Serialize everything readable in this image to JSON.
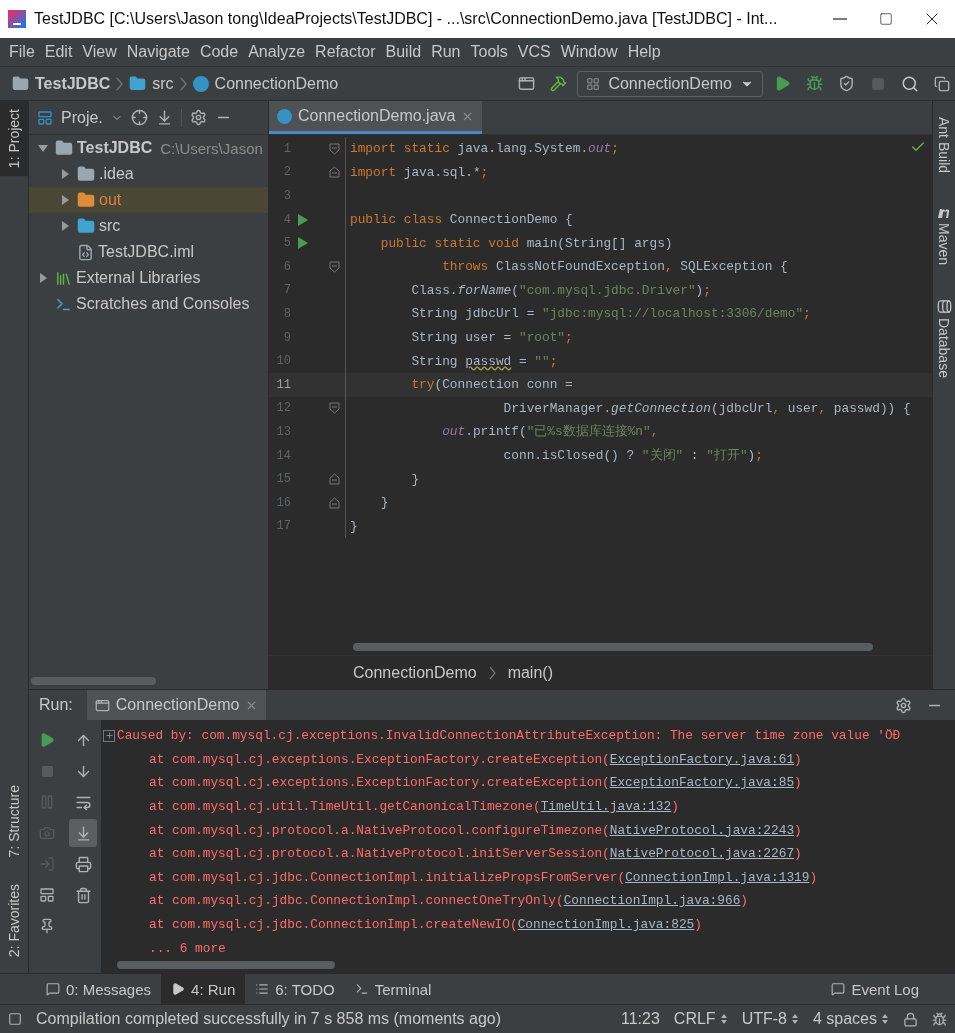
{
  "window": {
    "title": "TestJDBC [C:\\Users\\Jason tong\\IdeaProjects\\TestJDBC] - ...\\src\\ConnectionDemo.java [TestJDBC] - Int..."
  },
  "menu": [
    "File",
    "Edit",
    "View",
    "Navigate",
    "Code",
    "Analyze",
    "Refactor",
    "Build",
    "Run",
    "Tools",
    "VCS",
    "Window",
    "Help"
  ],
  "nav": {
    "breadcrumbs": [
      {
        "label": "TestJDBC",
        "kind": "module"
      },
      {
        "label": "src",
        "kind": "folder"
      },
      {
        "label": "ConnectionDemo",
        "kind": "class"
      }
    ],
    "run_config": "ConnectionDemo"
  },
  "left_stripe": [
    {
      "label": "1: Project",
      "selected": true,
      "kind": "top"
    },
    {
      "label": "7: Structure",
      "selected": false,
      "kind": "bottom"
    },
    {
      "label": "2: Favorites",
      "selected": false,
      "kind": "bottom"
    }
  ],
  "project_panel": {
    "title": "Proje.",
    "tree": [
      {
        "label": "TestJDBC",
        "detail": "C:\\Users\\Jason",
        "kind": "module",
        "expanded": true,
        "selected": false,
        "children": [
          {
            "label": ".idea",
            "kind": "folder",
            "expanded": false,
            "selected": false
          },
          {
            "label": "out",
            "kind": "excluded",
            "expanded": false,
            "selected": true
          },
          {
            "label": "src",
            "kind": "source",
            "expanded": false,
            "selected": false
          },
          {
            "label": "TestJDBC.iml",
            "kind": "file",
            "selected": false
          }
        ]
      },
      {
        "label": "External Libraries",
        "kind": "library",
        "expanded": false,
        "selected": false
      },
      {
        "label": "Scratches and Consoles",
        "kind": "scratch",
        "selected": false
      }
    ]
  },
  "editor": {
    "tabs": [
      {
        "label": "ConnectionDemo.java",
        "selected": true
      }
    ],
    "lines": [
      {
        "number": "1",
        "kind": "fold-start",
        "tokens": [
          {
            "kind": "keyword",
            "text": "import static "
          },
          {
            "kind": "plain",
            "text": "java.lang.System."
          },
          {
            "kind": "field",
            "text": "out"
          },
          {
            "kind": "keyword",
            "text": ";"
          }
        ]
      },
      {
        "number": "2",
        "kind": "fold-end",
        "tokens": [
          {
            "kind": "keyword",
            "text": "import "
          },
          {
            "kind": "plain",
            "text": "java.sql.*"
          },
          {
            "kind": "keyword",
            "text": ";"
          }
        ]
      },
      {
        "number": "3",
        "kind": "plain"
      },
      {
        "number": "4",
        "kind": "run",
        "tokens": [
          {
            "kind": "keyword",
            "text": "public class "
          },
          {
            "kind": "plain",
            "text": "ConnectionDemo {"
          }
        ]
      },
      {
        "number": "5",
        "kind": "run",
        "tokens": [
          {
            "kind": "keyword",
            "text": "    public static void "
          },
          {
            "kind": "plain",
            "text": "main(String[] args)"
          }
        ]
      },
      {
        "number": "6",
        "kind": "fold-start",
        "tokens": [
          {
            "kind": "keyword",
            "text": "            throws "
          },
          {
            "kind": "plain",
            "text": "ClassNotFoundException"
          },
          {
            "kind": "keyword",
            "text": ", "
          },
          {
            "kind": "plain",
            "text": "SQLException {"
          }
        ]
      },
      {
        "number": "7",
        "tokens": [
          {
            "kind": "plain",
            "text": "        Class."
          },
          {
            "kind": "method",
            "text": "forName"
          },
          {
            "kind": "plain",
            "text": "("
          },
          {
            "kind": "string",
            "text": "\"com.mysql.jdbc.Driver\""
          },
          {
            "kind": "plain",
            "text": ")"
          },
          {
            "kind": "keyword",
            "text": ";"
          }
        ]
      },
      {
        "number": "8",
        "tokens": [
          {
            "kind": "plain",
            "text": "        String jdbcUrl = "
          },
          {
            "kind": "string",
            "text": "\"jdbc:mysql://localhost:3306/demo\""
          },
          {
            "kind": "keyword",
            "text": ";"
          }
        ]
      },
      {
        "number": "9",
        "tokens": [
          {
            "kind": "plain",
            "text": "        String user = "
          },
          {
            "kind": "string",
            "text": "\"root\""
          },
          {
            "kind": "keyword",
            "text": ";"
          }
        ]
      },
      {
        "number": "10",
        "tokens": [
          {
            "kind": "plain",
            "text": "        String "
          },
          {
            "kind": "warning",
            "text": "passwd"
          },
          {
            "kind": "plain",
            "text": " = "
          },
          {
            "kind": "string",
            "text": "\"\""
          },
          {
            "kind": "keyword",
            "text": ";"
          }
        ]
      },
      {
        "number": "11",
        "current": true,
        "tokens": [
          {
            "kind": "keyword",
            "text": "        try"
          },
          {
            "kind": "plain",
            "text": "(Connection conn ="
          }
        ]
      },
      {
        "number": "12",
        "kind": "fold-start",
        "tokens": [
          {
            "kind": "plain",
            "text": "                    DriverManager."
          },
          {
            "kind": "method",
            "text": "getConnection"
          },
          {
            "kind": "plain",
            "text": "(jdbcUrl"
          },
          {
            "kind": "keyword",
            "text": ", "
          },
          {
            "kind": "plain",
            "text": "user"
          },
          {
            "kind": "keyword",
            "text": ", "
          },
          {
            "kind": "plain",
            "text": "passwd)) {"
          }
        ]
      },
      {
        "number": "13",
        "tokens": [
          {
            "kind": "field",
            "text": "            out"
          },
          {
            "kind": "plain",
            "text": ".printf("
          },
          {
            "kind": "string",
            "text": "\"已%s数据库连接%n\""
          },
          {
            "kind": "keyword",
            "text": ","
          }
        ]
      },
      {
        "number": "14",
        "tokens": [
          {
            "kind": "plain",
            "text": "                    conn.isClosed() ? "
          },
          {
            "kind": "string",
            "text": "\"关闭\""
          },
          {
            "kind": "plain",
            "text": " : "
          },
          {
            "kind": "string",
            "text": "\"打开\""
          },
          {
            "kind": "plain",
            "text": ")"
          },
          {
            "kind": "keyword",
            "text": ";"
          }
        ]
      },
      {
        "number": "15",
        "kind": "fold-end",
        "tokens": [
          {
            "kind": "plain",
            "text": "        }"
          }
        ]
      },
      {
        "number": "16",
        "kind": "fold-end",
        "tokens": [
          {
            "kind": "plain",
            "text": "    }"
          }
        ]
      },
      {
        "number": "17",
        "tokens": [
          {
            "kind": "plain",
            "text": "}"
          }
        ]
      }
    ],
    "breadcrumbs": [
      "ConnectionDemo",
      "main()"
    ]
  },
  "right_stripe": [
    {
      "label": "Ant Build",
      "kind": "ant"
    },
    {
      "label": "Maven",
      "kind": "maven"
    },
    {
      "label": "Database",
      "kind": "database"
    }
  ],
  "run_panel": {
    "label": "Run:",
    "tabs": [
      {
        "label": "ConnectionDemo",
        "selected": true
      }
    ],
    "console": [
      {
        "kind": "cause",
        "text": "Caused by: com.mysql.cj.exceptions.InvalidConnectionAttributeException: The server time zone value 'ÖÐ"
      },
      {
        "kind": "frame",
        "text": "at com.mysql.cj.exceptions.ExceptionFactory.createException(",
        "link": "ExceptionFactory.java:61",
        "end": ")"
      },
      {
        "kind": "frame",
        "text": "at com.mysql.cj.exceptions.ExceptionFactory.createException(",
        "link": "ExceptionFactory.java:85",
        "end": ")"
      },
      {
        "kind": "frame",
        "text": "at com.mysql.cj.util.TimeUtil.getCanonicalTimezone(",
        "link": "TimeUtil.java:132",
        "end": ")"
      },
      {
        "kind": "frame",
        "text": "at com.mysql.cj.protocol.a.NativeProtocol.configureTimezone(",
        "link": "NativeProtocol.java:2243",
        "end": ")"
      },
      {
        "kind": "frame",
        "text": "at com.mysql.cj.protocol.a.NativeProtocol.initServerSession(",
        "link": "NativeProtocol.java:2267",
        "end": ")"
      },
      {
        "kind": "frame",
        "text": "at com.mysql.cj.jdbc.ConnectionImpl.initializePropsFromServer(",
        "link": "ConnectionImpl.java:1319",
        "end": ")"
      },
      {
        "kind": "frame",
        "text": "at com.mysql.cj.jdbc.ConnectionImpl.connectOneTryOnly(",
        "link": "ConnectionImpl.java:966",
        "end": ")"
      },
      {
        "kind": "frame",
        "text": "at com.mysql.cj.jdbc.ConnectionImpl.createNewIO(",
        "link": "ConnectionImpl.java:825",
        "end": ")"
      },
      {
        "kind": "more",
        "text": "... 6 more"
      }
    ]
  },
  "bottom_tabs": [
    {
      "label": "0: Messages",
      "kind": "messages",
      "selected": false
    },
    {
      "label": "4: Run",
      "kind": "run",
      "selected": true
    },
    {
      "label": "6: TODO",
      "kind": "todo",
      "selected": false
    },
    {
      "label": "Terminal",
      "kind": "terminal",
      "selected": false
    }
  ],
  "event_log": "Event Log",
  "status_bar": {
    "message": "Compilation completed successfully in 7 s 858 ms (moments ago)",
    "position": "11:23",
    "line_separator": "CRLF",
    "encoding": "UTF-8",
    "indent": "4 spaces"
  }
}
